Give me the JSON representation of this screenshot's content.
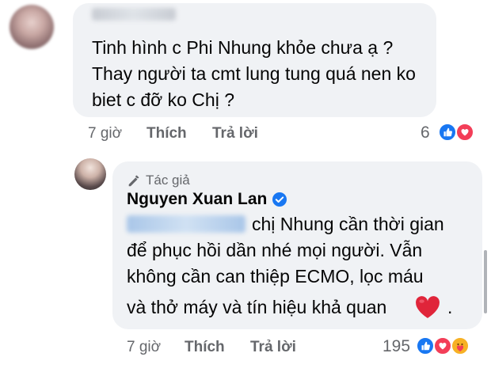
{
  "comment1": {
    "author_name": "Nguyen Thi",
    "lines": [
      "Tinh hình c Phi Nhung khỏe chưa ạ ?",
      "Thay người ta cmt lung tung quá nen ko",
      "biet c đỡ ko Chị ?"
    ],
    "time": "7 giờ",
    "like_label": "Thích",
    "reply_label": "Trả lời",
    "reaction_count": "6",
    "reactions": [
      "like-icon",
      "heart-icon"
    ]
  },
  "reply": {
    "author_badge": "Tác giả",
    "author_name": "Nguyen Xuan Lan",
    "mention": "Nguyen Thi",
    "lines": [
      "chị Nhung cần thời gian",
      "để phục hồi dần nhé mọi người. Vẫn",
      "không cần can thiệp ECMO, lọc máu",
      "và thở máy và tín hiệu khả quan "
    ],
    "end_punct": ".",
    "time": "7 giờ",
    "like_label": "Thích",
    "reply_label": "Trả lời",
    "reaction_count": "195",
    "reactions": [
      "like-icon",
      "heart-icon",
      "care-icon"
    ]
  },
  "colors": {
    "bubble_bg": "#f0f2f5",
    "meta_text": "#65676b",
    "like_blue": "#1877f2",
    "heart_red": "#f33e58",
    "care_yellow": "#f7b125"
  }
}
